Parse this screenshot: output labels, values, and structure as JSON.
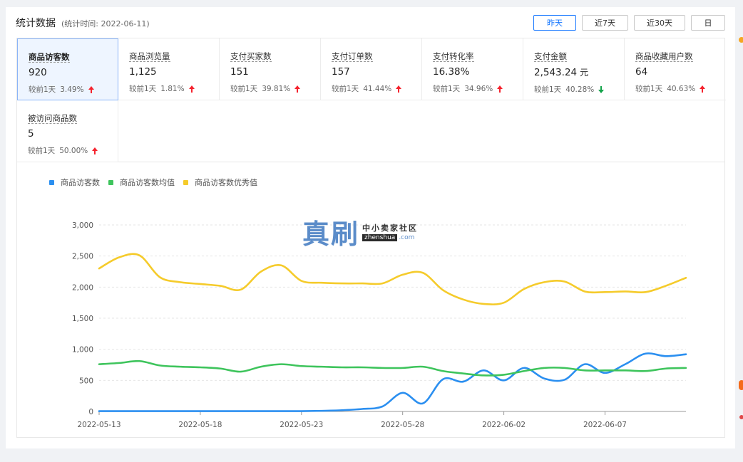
{
  "header": {
    "title": "统计数据",
    "subtitle": "(统计时间: 2022-06-11)"
  },
  "range_buttons": [
    {
      "label": "昨天",
      "active": true
    },
    {
      "label": "近7天",
      "active": false
    },
    {
      "label": "近30天",
      "active": false
    },
    {
      "label": "日",
      "active": false
    }
  ],
  "stats": [
    {
      "label": "商品访客数",
      "value": "920",
      "unit": "",
      "compare": "较前1天",
      "pct": "3.49%",
      "trend": "up",
      "active": true
    },
    {
      "label": "商品浏览量",
      "value": "1,125",
      "unit": "",
      "compare": "较前1天",
      "pct": "1.81%",
      "trend": "up",
      "active": false
    },
    {
      "label": "支付买家数",
      "value": "151",
      "unit": "",
      "compare": "较前1天",
      "pct": "39.81%",
      "trend": "up",
      "active": false
    },
    {
      "label": "支付订单数",
      "value": "157",
      "unit": "",
      "compare": "较前1天",
      "pct": "41.44%",
      "trend": "up",
      "active": false
    },
    {
      "label": "支付转化率",
      "value": "16.38%",
      "unit": "",
      "compare": "较前1天",
      "pct": "34.96%",
      "trend": "up",
      "active": false
    },
    {
      "label": "支付金额",
      "value": "2,543.24",
      "unit": "元",
      "compare": "较前1天",
      "pct": "40.28%",
      "trend": "down",
      "active": false
    },
    {
      "label": "商品收藏用户数",
      "value": "64",
      "unit": "",
      "compare": "较前1天",
      "pct": "40.63%",
      "trend": "up",
      "active": false
    },
    {
      "label": "被访问商品数",
      "value": "5",
      "unit": "",
      "compare": "较前1天",
      "pct": "50.00%",
      "trend": "up",
      "active": false
    }
  ],
  "watermark": {
    "big": "真刷",
    "small": "中小卖家社区",
    "url_box": "zhenshua",
    "url_tail": ".com"
  },
  "chart_data": {
    "type": "line",
    "ylim": [
      0,
      3000
    ],
    "yticks": [
      0,
      500,
      1000,
      1500,
      2000,
      2500,
      3000
    ],
    "ytick_labels": [
      "0",
      "500",
      "1,000",
      "1,500",
      "2,000",
      "2,500",
      "3,000"
    ],
    "xtick_labels": [
      "2022-05-13",
      "2022-05-18",
      "2022-05-23",
      "2022-05-28",
      "2022-06-02",
      "2022-06-07"
    ],
    "xtick_index": [
      0,
      5,
      10,
      15,
      20,
      25
    ],
    "x": [
      "2022-05-13",
      "2022-05-14",
      "2022-05-15",
      "2022-05-16",
      "2022-05-17",
      "2022-05-18",
      "2022-05-19",
      "2022-05-20",
      "2022-05-21",
      "2022-05-22",
      "2022-05-23",
      "2022-05-24",
      "2022-05-25",
      "2022-05-26",
      "2022-05-27",
      "2022-05-28",
      "2022-05-29",
      "2022-05-30",
      "2022-05-31",
      "2022-06-01",
      "2022-06-02",
      "2022-06-03",
      "2022-06-04",
      "2022-06-05",
      "2022-06-06",
      "2022-06-07",
      "2022-06-08",
      "2022-06-09",
      "2022-06-10",
      "2022-06-11"
    ],
    "grid": true,
    "legend_position": "top-left",
    "series": [
      {
        "name": "商品访客数",
        "color": "#2b8ff0",
        "values": [
          5,
          5,
          5,
          5,
          5,
          5,
          5,
          5,
          5,
          5,
          5,
          10,
          20,
          40,
          80,
          300,
          130,
          520,
          480,
          660,
          500,
          700,
          530,
          510,
          760,
          620,
          760,
          930,
          890,
          920
        ]
      },
      {
        "name": "商品访客数均值",
        "color": "#3ec45c",
        "values": [
          760,
          780,
          810,
          740,
          720,
          710,
          690,
          640,
          720,
          760,
          730,
          720,
          710,
          710,
          700,
          700,
          720,
          650,
          610,
          580,
          590,
          650,
          700,
          700,
          660,
          660,
          660,
          650,
          690,
          700
        ]
      },
      {
        "name": "商品访客数优秀值",
        "color": "#f5cb2b",
        "values": [
          2300,
          2480,
          2510,
          2160,
          2080,
          2050,
          2020,
          1960,
          2250,
          2350,
          2100,
          2070,
          2060,
          2060,
          2060,
          2200,
          2230,
          1950,
          1800,
          1730,
          1750,
          1970,
          2080,
          2090,
          1930,
          1920,
          1930,
          1920,
          2020,
          2150
        ]
      }
    ]
  }
}
